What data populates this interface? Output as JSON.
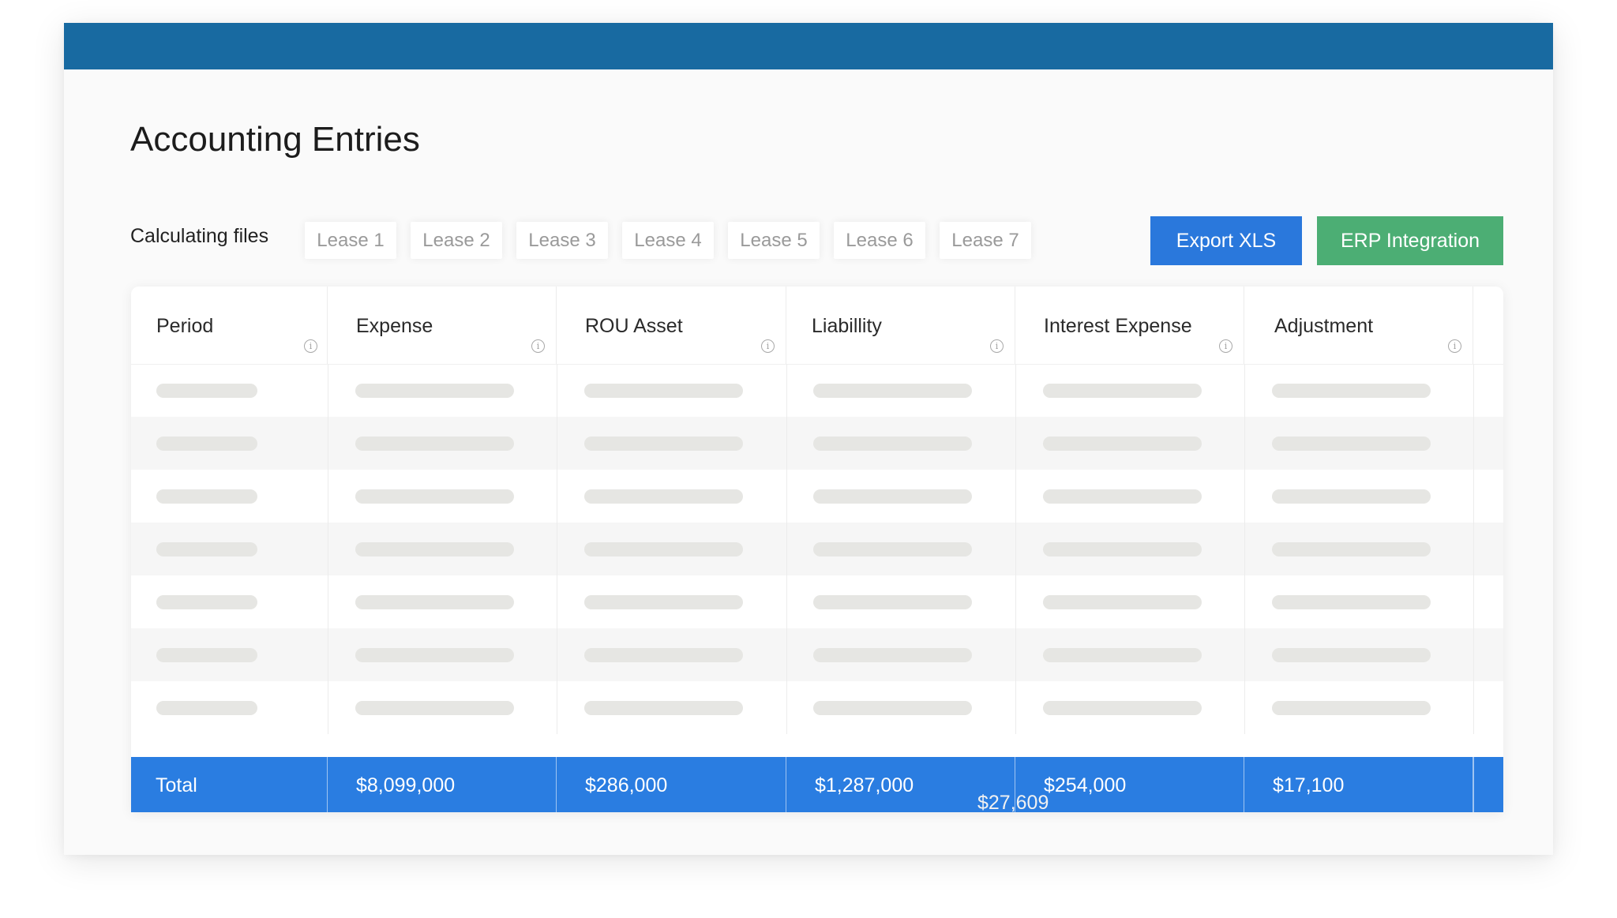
{
  "page": {
    "title": "Accounting Entries"
  },
  "toolbar": {
    "files_label": "Calculating files",
    "lease_tabs": [
      "Lease 1",
      "Lease 2",
      "Lease 3",
      "Lease 4",
      "Lease 5",
      "Lease 6",
      "Lease 7"
    ],
    "export_label": "Export XLS",
    "erp_label": "ERP Integration"
  },
  "table": {
    "columns": [
      "Period",
      "Expense",
      "ROU Asset",
      "Liabillity",
      "Interest Expense",
      "Adjustment"
    ],
    "info_icon": "info-icon",
    "placeholder_rows": 7,
    "total": {
      "label": "Total",
      "values": [
        "$8,099,000",
        "$286,000",
        "$1,287,000",
        "$254,000",
        "$17,100"
      ]
    },
    "ghost_value": "$27,609"
  },
  "colors": {
    "top_bar": "#186aa1",
    "export_button": "#2a78dc",
    "erp_button": "#4cae74",
    "total_row": "#2a7de1",
    "skeleton": "#e6e6e3"
  }
}
